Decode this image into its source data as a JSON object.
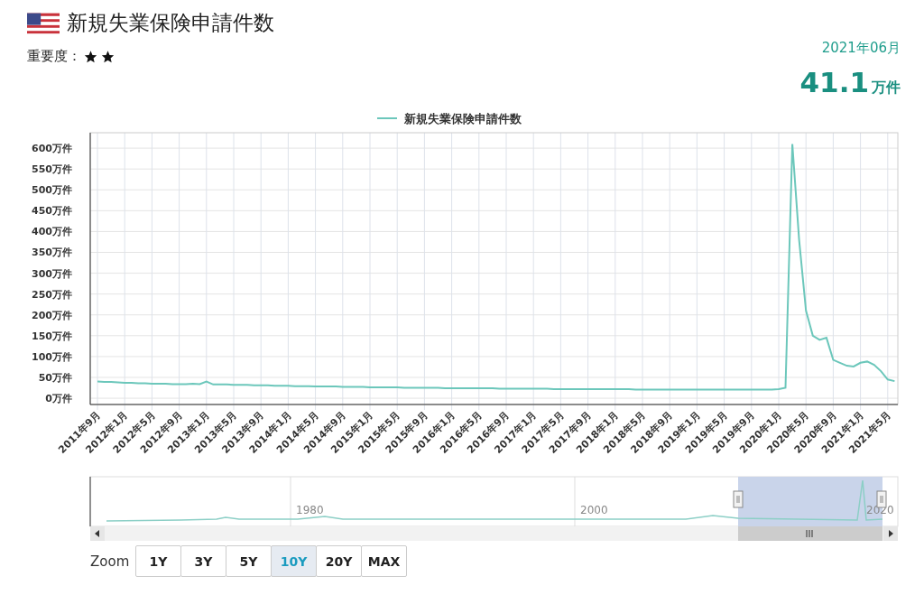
{
  "header": {
    "title": "新規失業保険申請件数",
    "importance_label": "重要度：",
    "stars": 2,
    "date": "2021年06月",
    "value": "41.1",
    "unit": "万件"
  },
  "chart": {
    "chart_data": {
      "type": "line",
      "grid": true,
      "ylim": [
        -15,
        637
      ],
      "yticks": [
        {
          "value": 0,
          "label": "0万件"
        },
        {
          "value": 50,
          "label": "50万件"
        },
        {
          "value": 100,
          "label": "100万件"
        },
        {
          "value": 150,
          "label": "150万件"
        },
        {
          "value": 200,
          "label": "200万件"
        },
        {
          "value": 250,
          "label": "250万件"
        },
        {
          "value": 300,
          "label": "300万件"
        },
        {
          "value": 350,
          "label": "350万件"
        },
        {
          "value": 400,
          "label": "400万件"
        },
        {
          "value": 450,
          "label": "450万件"
        },
        {
          "value": 500,
          "label": "500万件"
        },
        {
          "value": 550,
          "label": "550万件"
        },
        {
          "value": 600,
          "label": "600万件"
        }
      ],
      "categories": [
        "2011年9月",
        null,
        null,
        null,
        "2012年1月",
        null,
        null,
        null,
        "2012年5月",
        null,
        null,
        null,
        "2012年9月",
        null,
        null,
        null,
        "2013年1月",
        null,
        null,
        null,
        "2013年5月",
        null,
        null,
        null,
        "2013年9月",
        null,
        null,
        null,
        "2014年1月",
        null,
        null,
        null,
        "2014年5月",
        null,
        null,
        null,
        "2014年9月",
        null,
        null,
        null,
        "2015年1月",
        null,
        null,
        null,
        "2015年5月",
        null,
        null,
        null,
        "2015年9月",
        null,
        null,
        null,
        "2016年1月",
        null,
        null,
        null,
        "2016年5月",
        null,
        null,
        null,
        "2016年9月",
        null,
        null,
        null,
        "2017年1月",
        null,
        null,
        null,
        "2017年5月",
        null,
        null,
        null,
        "2017年9月",
        null,
        null,
        null,
        "2018年1月",
        null,
        null,
        null,
        "2018年5月",
        null,
        null,
        null,
        "2018年9月",
        null,
        null,
        null,
        "2019年1月",
        null,
        null,
        null,
        "2019年5月",
        null,
        null,
        null,
        "2019年9月",
        null,
        null,
        null,
        "2020年1月",
        null,
        null,
        null,
        "2020年5月",
        null,
        null,
        null,
        "2020年9月",
        null,
        null,
        null,
        "2021年1月",
        null,
        null,
        null,
        "2021年5月",
        null
      ],
      "series": [
        {
          "name": "新規失業保険申請件数",
          "color": "#6cc7bb",
          "values": [
            40,
            39,
            39,
            38,
            37,
            37,
            36,
            36,
            35,
            35,
            35,
            34,
            34,
            34,
            35,
            34,
            40,
            33,
            33,
            33,
            32,
            32,
            32,
            31,
            31,
            31,
            30,
            30,
            30,
            29,
            29,
            29,
            28,
            28,
            28,
            28,
            27,
            27,
            27,
            27,
            26,
            26,
            26,
            26,
            26,
            25,
            25,
            25,
            25,
            25,
            25,
            24,
            24,
            24,
            24,
            24,
            24,
            24,
            24,
            23,
            23,
            23,
            23,
            23,
            23,
            23,
            23,
            22,
            22,
            22,
            22,
            22,
            22,
            22,
            22,
            22,
            22,
            22,
            22,
            21,
            21,
            21,
            21,
            21,
            21,
            21,
            21,
            21,
            21,
            21,
            21,
            21,
            21,
            21,
            21,
            21,
            21,
            21,
            21,
            21,
            22,
            25,
            610,
            380,
            210,
            150,
            140,
            145,
            92,
            85,
            78,
            76,
            85,
            88,
            80,
            65,
            45,
            41
          ]
        }
      ]
    }
  },
  "navigator": {
    "labels": [
      "1980",
      "2000",
      "2020"
    ]
  },
  "zoom": {
    "label": "Zoom",
    "buttons": [
      {
        "label": "1Y",
        "selected": false
      },
      {
        "label": "3Y",
        "selected": false
      },
      {
        "label": "5Y",
        "selected": false
      },
      {
        "label": "10Y",
        "selected": true
      },
      {
        "label": "20Y",
        "selected": false
      },
      {
        "label": "MAX",
        "selected": false
      }
    ]
  }
}
